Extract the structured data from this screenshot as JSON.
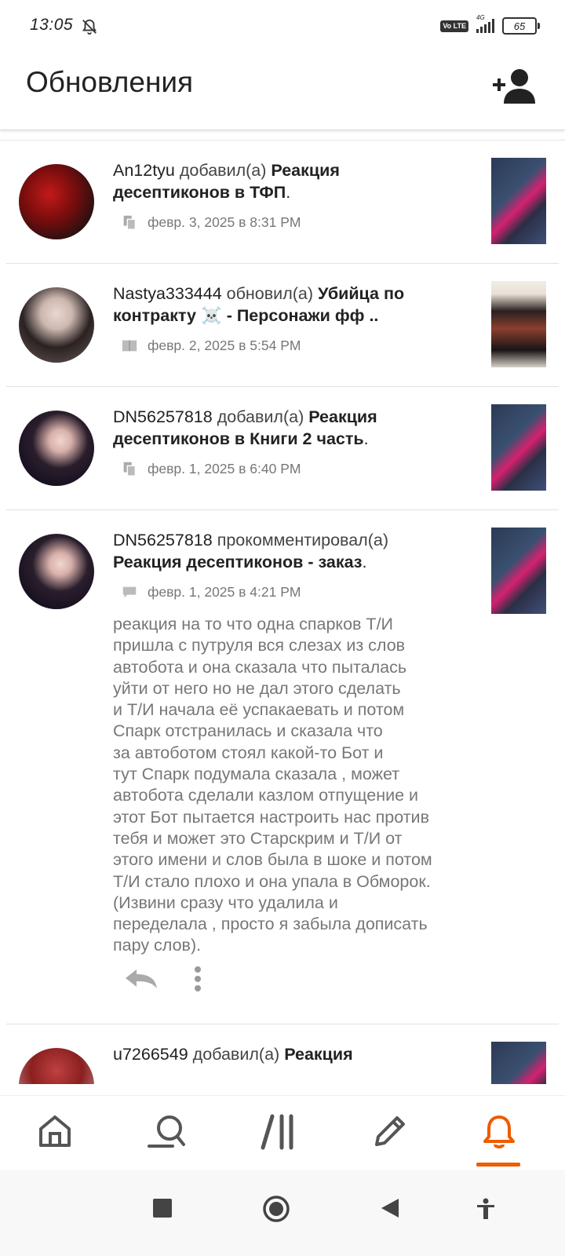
{
  "status": {
    "time": "13:05",
    "network": "4G",
    "volte": "Vo LTE",
    "battery": "65"
  },
  "header": {
    "title": "Обновления"
  },
  "feed": [
    {
      "user": "An12tyu",
      "verb": "добавил(а)",
      "target_start": "Реакция",
      "target_end": "десептиконов в ТФП",
      "suffix": ".",
      "date": "февр. 3, 2025 в 8:31 PM",
      "meta_icon": "copy-icon"
    },
    {
      "user": "Nastya333444",
      "verb": "обновил(а)",
      "target_start": "Убийца по",
      "target_end": "контракту ☠️ - Персонажи фф ..",
      "suffix": "",
      "date": "февр. 2, 2025 в 5:54 PM",
      "meta_icon": "book-icon"
    },
    {
      "user": "DN56257818",
      "verb": "добавил(а)",
      "target_start": "Реакция",
      "target_end": "десептиконов в Книги 2 часть",
      "suffix": ".",
      "date": "февр. 1, 2025 в 6:40 PM",
      "meta_icon": "copy-icon"
    },
    {
      "user": "DN56257818",
      "verb": "прокомментировал(а)",
      "target_start": "",
      "target_end": "Реакция десептиконов - заказ",
      "suffix": ".",
      "date": "февр. 1, 2025 в 4:21 PM",
      "meta_icon": "comment-icon",
      "comment_lines": [
        "реакция на то что одна спарков Т/И",
        "пришла с путруля вся слезах из слов",
        "автобота и она сказала что пыталась",
        "уйти от него но не дал этого сделать",
        "и Т/И начала её успакаевать и потом",
        "Спарк отстранилась и сказала что",
        "за автоботом стоял какой-то Бот и",
        "тут Спарк подумала сказала , может",
        "автобота сделали казлом отпущение и",
        "этот Бот пытается настроить нас против",
        "тебя и может это Старскрим и Т/И от",
        "этого имени и слов была в шоке и потом",
        "Т/И стало плохо и она упала в Обморок.",
        "(Извини сразу что удалила и",
        "переделала , просто я забыла дописать",
        "пару слов)."
      ]
    },
    {
      "user": "u7266549",
      "verb": "добавил(а)",
      "target_start": "Реакция",
      "target_end": "",
      "suffix": "",
      "date": "",
      "meta_icon": ""
    }
  ],
  "bottom_nav": [
    "home-icon",
    "discover-icon",
    "library-icon",
    "write-icon",
    "notifications-icon"
  ],
  "colors": {
    "accent": "#f05a00",
    "muted": "#777777",
    "text": "#222222"
  }
}
